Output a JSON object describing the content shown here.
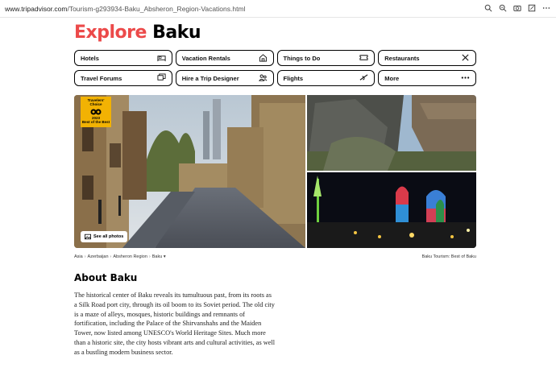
{
  "browser": {
    "url_host": "www.tripadvisor.com",
    "url_path": "/Tourism-g293934-Baku_Absheron_Region-Vacations.html",
    "icons": [
      "search-icon",
      "zoom-icon",
      "camera-icon",
      "share-icon",
      "more-icon"
    ]
  },
  "header": {
    "title_accent": "Explore",
    "title_city": "Baku"
  },
  "nav": [
    {
      "label": "Hotels",
      "icon": "bed-icon"
    },
    {
      "label": "Vacation Rentals",
      "icon": "house-icon"
    },
    {
      "label": "Things to Do",
      "icon": "ticket-icon"
    },
    {
      "label": "Restaurants",
      "icon": "utensils-icon"
    },
    {
      "label": "Travel Forums",
      "icon": "chat-icon"
    },
    {
      "label": "Hire a Trip Designer",
      "icon": "people-icon"
    },
    {
      "label": "Flights",
      "icon": "plane-icon"
    },
    {
      "label": "More",
      "icon": "dots-icon"
    }
  ],
  "photos": {
    "badge_line1": "Travelers'",
    "badge_line2": "Choice",
    "badge_year": "2023",
    "badge_line3": "Best of the Best",
    "see_all": "See all photos"
  },
  "breadcrumb": {
    "items": [
      "Asia",
      "Azerbaijan",
      "Absheron Region",
      "Baku"
    ],
    "right": "Baku Tourism: Best of Baku"
  },
  "about": {
    "heading": "About Baku",
    "text": "The historical center of Baku reveals its tumultuous past, from its roots as a Silk Road port city, through its oil boom to its Soviet period. The old city is a maze of alleys, mosques, historic buildings and remnants of fortification, including the Palace of the Shirvanshahs and the Maiden Tower, now listed among UNESCO's World Heritage Sites. Much more than a historic site, the city hosts vibrant arts and cultural activities, as well as a bustling modern business sector."
  },
  "colors": {
    "brand_accent": "#ec4a4a",
    "badge": "#f2b203"
  }
}
